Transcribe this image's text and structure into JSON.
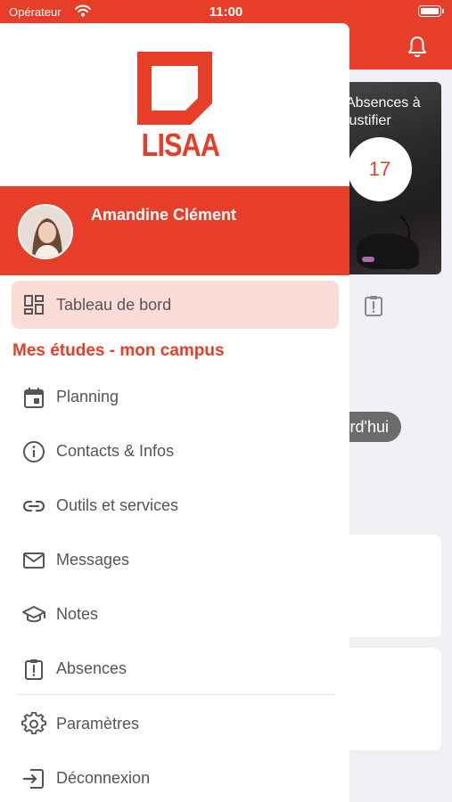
{
  "status_bar": {
    "carrier": "Opérateur",
    "time": "11:00"
  },
  "background": {
    "absences_card_label": "Absences à justifier",
    "absences_count": "17",
    "today_pill": "rd'hui"
  },
  "drawer": {
    "brand": "LISAA",
    "user_name": "Amandine Clément",
    "dashboard_label": "Tableau de bord",
    "section_title": "Mes études - mon campus",
    "items": [
      {
        "label": "Planning",
        "icon": "calendar-icon"
      },
      {
        "label": "Contacts & Infos",
        "icon": "info-icon"
      },
      {
        "label": "Outils et services",
        "icon": "link-icon"
      },
      {
        "label": "Messages",
        "icon": "mail-icon"
      },
      {
        "label": "Notes",
        "icon": "graduation-cap-icon"
      },
      {
        "label": "Absences",
        "icon": "clipboard-alert-icon"
      },
      {
        "label": "Paramètres",
        "icon": "gear-icon"
      },
      {
        "label": "Déconnexion",
        "icon": "logout-icon"
      }
    ]
  },
  "colors": {
    "brand": "#e63e29",
    "active_bg": "#fbdcd7",
    "text": "#555555"
  }
}
